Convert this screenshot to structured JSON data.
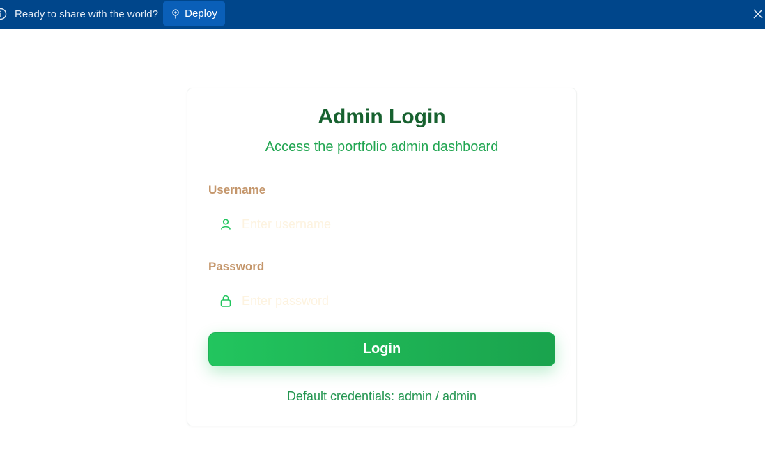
{
  "banner": {
    "message": "Ready to share with the world?",
    "deploy_label": "Deploy",
    "bg_color": "#00468b",
    "icons": [
      "info-icon",
      "deploy-icon",
      "close-icon"
    ]
  },
  "login": {
    "title": "Admin Login",
    "subtitle": "Access the portfolio admin dashboard",
    "username_label": "Username",
    "username_placeholder": "Enter username",
    "username_value": "",
    "username_icon": "user-icon",
    "password_label": "Password",
    "password_placeholder": "Enter password",
    "password_value": "",
    "password_icon": "lock-icon",
    "button_label": "Login",
    "credentials_hint": "Default credentials: admin / admin",
    "accent_color": "#22c55e",
    "title_color": "#17612f",
    "label_color": "#c4966b"
  }
}
